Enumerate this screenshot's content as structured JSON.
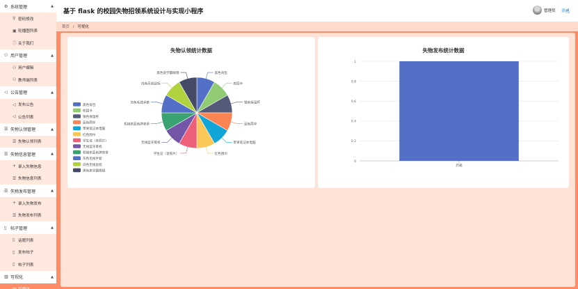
{
  "header": {
    "title": "基于 flask 的校园失物招领系统设计与实现小程序",
    "username": "管理员",
    "logout": "退出"
  },
  "breadcrumb": {
    "home": "首页",
    "sep": "/",
    "current": "可视化"
  },
  "sidebar": {
    "groups": [
      {
        "label": "系统管理",
        "icon": "gear-icon",
        "items": [
          {
            "label": "密码修改",
            "icon": "key-icon"
          },
          {
            "label": "轮播图列表",
            "icon": "image-icon"
          },
          {
            "label": "关于我们",
            "icon": "info-icon"
          }
        ]
      },
      {
        "label": "用户管理",
        "icon": "user-icon",
        "items": [
          {
            "label": "用户编辑",
            "icon": "user-icon"
          },
          {
            "label": "教师端列表",
            "icon": "user-icon"
          }
        ]
      },
      {
        "label": "公告管理",
        "icon": "speaker-icon",
        "items": [
          {
            "label": "发布公告",
            "icon": "megaphone-icon"
          },
          {
            "label": "公告列表",
            "icon": "megaphone-icon"
          }
        ]
      },
      {
        "label": "失物认领管理",
        "icon": "list-icon",
        "items": [
          {
            "label": "失物认领列表",
            "icon": "list-icon"
          }
        ]
      },
      {
        "label": "失物信息管理",
        "icon": "list-icon",
        "items": [
          {
            "label": "录入失物信息",
            "icon": "plus-icon"
          },
          {
            "label": "失物信息列表",
            "icon": "list-icon"
          }
        ]
      },
      {
        "label": "失物发布管理",
        "icon": "list-icon",
        "items": [
          {
            "label": "录入失物发布",
            "icon": "plus-icon"
          },
          {
            "label": "失物发布列表",
            "icon": "list-icon"
          }
        ]
      },
      {
        "label": "帖子管理",
        "icon": "doc-icon",
        "items": [
          {
            "label": "话题列表",
            "icon": "doc-icon"
          },
          {
            "label": "发布帖子",
            "icon": "doc-icon"
          },
          {
            "label": "帖子列表",
            "icon": "doc-icon"
          }
        ]
      },
      {
        "label": "可视化",
        "icon": "chart-icon",
        "items": [
          {
            "label": "可视化",
            "icon": "chart-icon",
            "active": true
          }
        ]
      }
    ]
  },
  "chart_data": [
    {
      "type": "pie",
      "title": "失物认领统计数据",
      "legend_position": "left",
      "categories": [
        "黑色背包",
        "校园卡",
        "银色保温杯",
        "蓝色雨伞",
        "苹果笔记本电脑",
        "红色围巾",
        "学生证（含照片）",
        "无线蓝牙耳机",
        "机械表蓝色牌表带",
        "灰色毛线手套",
        "白色无线鼠标",
        "黑色皮学霸眼镜"
      ],
      "values": [
        1,
        1,
        1,
        1,
        1,
        1,
        1,
        1,
        1,
        1,
        1,
        1
      ],
      "colors": [
        "#5470c6",
        "#91cc75",
        "#535b78",
        "#fc8452",
        "#12a6d8",
        "#fac858",
        "#ee6079",
        "#7456a8",
        "#3ba272",
        "#5470c6",
        "#b0d23e",
        "#454a66"
      ],
      "slice_labels": [
        "黑色背包",
        "校园卡",
        "银色保温杯",
        "蓝色雨伞",
        "苹果笔记本电脑",
        "红色围巾",
        "学生证（含照片）",
        "无线蓝牙耳机",
        "机械表蓝色牌表带",
        "灰色毛线手套",
        "白色无线鼠标",
        "黑色皮学霸眼镜"
      ]
    },
    {
      "type": "bar",
      "title": "失物发布统计数据",
      "categories": [
        "药箱"
      ],
      "values": [
        1
      ],
      "ylim": [
        0,
        1
      ],
      "yticks": [
        "0",
        "0.2",
        "0.4",
        "0.6",
        "0.8",
        "1"
      ],
      "color": "#5470c6",
      "grid": true
    }
  ]
}
